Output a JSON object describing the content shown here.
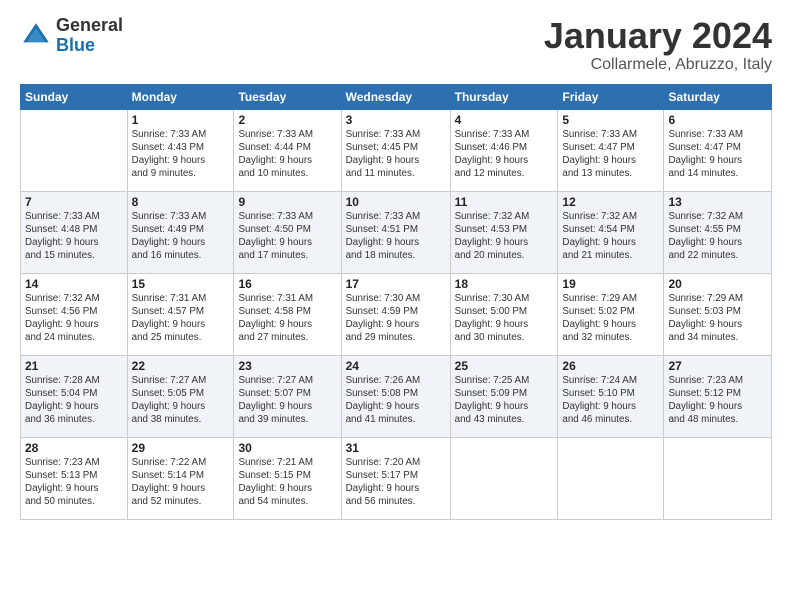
{
  "logo": {
    "general": "General",
    "blue": "Blue"
  },
  "title": "January 2024",
  "subtitle": "Collarmele, Abruzzo, Italy",
  "header_days": [
    "Sunday",
    "Monday",
    "Tuesday",
    "Wednesday",
    "Thursday",
    "Friday",
    "Saturday"
  ],
  "weeks": [
    [
      {
        "day": "",
        "info": ""
      },
      {
        "day": "1",
        "info": "Sunrise: 7:33 AM\nSunset: 4:43 PM\nDaylight: 9 hours\nand 9 minutes."
      },
      {
        "day": "2",
        "info": "Sunrise: 7:33 AM\nSunset: 4:44 PM\nDaylight: 9 hours\nand 10 minutes."
      },
      {
        "day": "3",
        "info": "Sunrise: 7:33 AM\nSunset: 4:45 PM\nDaylight: 9 hours\nand 11 minutes."
      },
      {
        "day": "4",
        "info": "Sunrise: 7:33 AM\nSunset: 4:46 PM\nDaylight: 9 hours\nand 12 minutes."
      },
      {
        "day": "5",
        "info": "Sunrise: 7:33 AM\nSunset: 4:47 PM\nDaylight: 9 hours\nand 13 minutes."
      },
      {
        "day": "6",
        "info": "Sunrise: 7:33 AM\nSunset: 4:47 PM\nDaylight: 9 hours\nand 14 minutes."
      }
    ],
    [
      {
        "day": "7",
        "info": "Sunrise: 7:33 AM\nSunset: 4:48 PM\nDaylight: 9 hours\nand 15 minutes."
      },
      {
        "day": "8",
        "info": "Sunrise: 7:33 AM\nSunset: 4:49 PM\nDaylight: 9 hours\nand 16 minutes."
      },
      {
        "day": "9",
        "info": "Sunrise: 7:33 AM\nSunset: 4:50 PM\nDaylight: 9 hours\nand 17 minutes."
      },
      {
        "day": "10",
        "info": "Sunrise: 7:33 AM\nSunset: 4:51 PM\nDaylight: 9 hours\nand 18 minutes."
      },
      {
        "day": "11",
        "info": "Sunrise: 7:32 AM\nSunset: 4:53 PM\nDaylight: 9 hours\nand 20 minutes."
      },
      {
        "day": "12",
        "info": "Sunrise: 7:32 AM\nSunset: 4:54 PM\nDaylight: 9 hours\nand 21 minutes."
      },
      {
        "day": "13",
        "info": "Sunrise: 7:32 AM\nSunset: 4:55 PM\nDaylight: 9 hours\nand 22 minutes."
      }
    ],
    [
      {
        "day": "14",
        "info": "Sunrise: 7:32 AM\nSunset: 4:56 PM\nDaylight: 9 hours\nand 24 minutes."
      },
      {
        "day": "15",
        "info": "Sunrise: 7:31 AM\nSunset: 4:57 PM\nDaylight: 9 hours\nand 25 minutes."
      },
      {
        "day": "16",
        "info": "Sunrise: 7:31 AM\nSunset: 4:58 PM\nDaylight: 9 hours\nand 27 minutes."
      },
      {
        "day": "17",
        "info": "Sunrise: 7:30 AM\nSunset: 4:59 PM\nDaylight: 9 hours\nand 29 minutes."
      },
      {
        "day": "18",
        "info": "Sunrise: 7:30 AM\nSunset: 5:00 PM\nDaylight: 9 hours\nand 30 minutes."
      },
      {
        "day": "19",
        "info": "Sunrise: 7:29 AM\nSunset: 5:02 PM\nDaylight: 9 hours\nand 32 minutes."
      },
      {
        "day": "20",
        "info": "Sunrise: 7:29 AM\nSunset: 5:03 PM\nDaylight: 9 hours\nand 34 minutes."
      }
    ],
    [
      {
        "day": "21",
        "info": "Sunrise: 7:28 AM\nSunset: 5:04 PM\nDaylight: 9 hours\nand 36 minutes."
      },
      {
        "day": "22",
        "info": "Sunrise: 7:27 AM\nSunset: 5:05 PM\nDaylight: 9 hours\nand 38 minutes."
      },
      {
        "day": "23",
        "info": "Sunrise: 7:27 AM\nSunset: 5:07 PM\nDaylight: 9 hours\nand 39 minutes."
      },
      {
        "day": "24",
        "info": "Sunrise: 7:26 AM\nSunset: 5:08 PM\nDaylight: 9 hours\nand 41 minutes."
      },
      {
        "day": "25",
        "info": "Sunrise: 7:25 AM\nSunset: 5:09 PM\nDaylight: 9 hours\nand 43 minutes."
      },
      {
        "day": "26",
        "info": "Sunrise: 7:24 AM\nSunset: 5:10 PM\nDaylight: 9 hours\nand 46 minutes."
      },
      {
        "day": "27",
        "info": "Sunrise: 7:23 AM\nSunset: 5:12 PM\nDaylight: 9 hours\nand 48 minutes."
      }
    ],
    [
      {
        "day": "28",
        "info": "Sunrise: 7:23 AM\nSunset: 5:13 PM\nDaylight: 9 hours\nand 50 minutes."
      },
      {
        "day": "29",
        "info": "Sunrise: 7:22 AM\nSunset: 5:14 PM\nDaylight: 9 hours\nand 52 minutes."
      },
      {
        "day": "30",
        "info": "Sunrise: 7:21 AM\nSunset: 5:15 PM\nDaylight: 9 hours\nand 54 minutes."
      },
      {
        "day": "31",
        "info": "Sunrise: 7:20 AM\nSunset: 5:17 PM\nDaylight: 9 hours\nand 56 minutes."
      },
      {
        "day": "",
        "info": ""
      },
      {
        "day": "",
        "info": ""
      },
      {
        "day": "",
        "info": ""
      }
    ]
  ]
}
